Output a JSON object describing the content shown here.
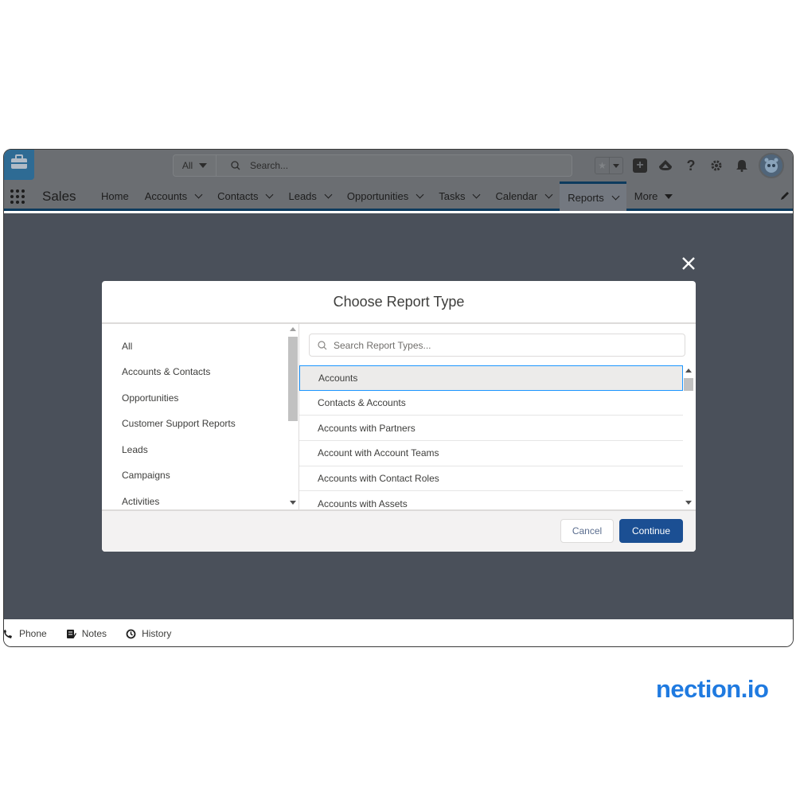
{
  "header": {
    "search_scope": "All",
    "search_placeholder": "Search..."
  },
  "nav": {
    "app_name": "Sales",
    "items": [
      {
        "label": "Home",
        "has_menu": false
      },
      {
        "label": "Accounts",
        "has_menu": true
      },
      {
        "label": "Contacts",
        "has_menu": true
      },
      {
        "label": "Leads",
        "has_menu": true
      },
      {
        "label": "Opportunities",
        "has_menu": true
      },
      {
        "label": "Tasks",
        "has_menu": true
      },
      {
        "label": "Calendar",
        "has_menu": true
      },
      {
        "label": "Reports",
        "has_menu": true,
        "active": true
      },
      {
        "label": "More",
        "has_menu": true
      }
    ]
  },
  "modal": {
    "title": "Choose Report Type",
    "categories": [
      "All",
      "Accounts & Contacts",
      "Opportunities",
      "Customer Support Reports",
      "Leads",
      "Campaigns",
      "Activities"
    ],
    "search_placeholder": "Search Report Types...",
    "report_types": [
      {
        "label": "Accounts",
        "selected": true
      },
      {
        "label": "Contacts & Accounts"
      },
      {
        "label": "Accounts with Partners"
      },
      {
        "label": "Account with Account Teams"
      },
      {
        "label": "Accounts with Contact Roles"
      },
      {
        "label": "Accounts with Assets"
      }
    ],
    "cancel_label": "Cancel",
    "continue_label": "Continue"
  },
  "utility_bar": {
    "items": [
      "Phone",
      "Notes",
      "History"
    ]
  },
  "watermark": "nection.io",
  "colors": {
    "brand_blue": "#1b4f93",
    "selection_border": "#1b96ff",
    "watermark": "#1f7ae0",
    "overlay": "#4a505a"
  }
}
